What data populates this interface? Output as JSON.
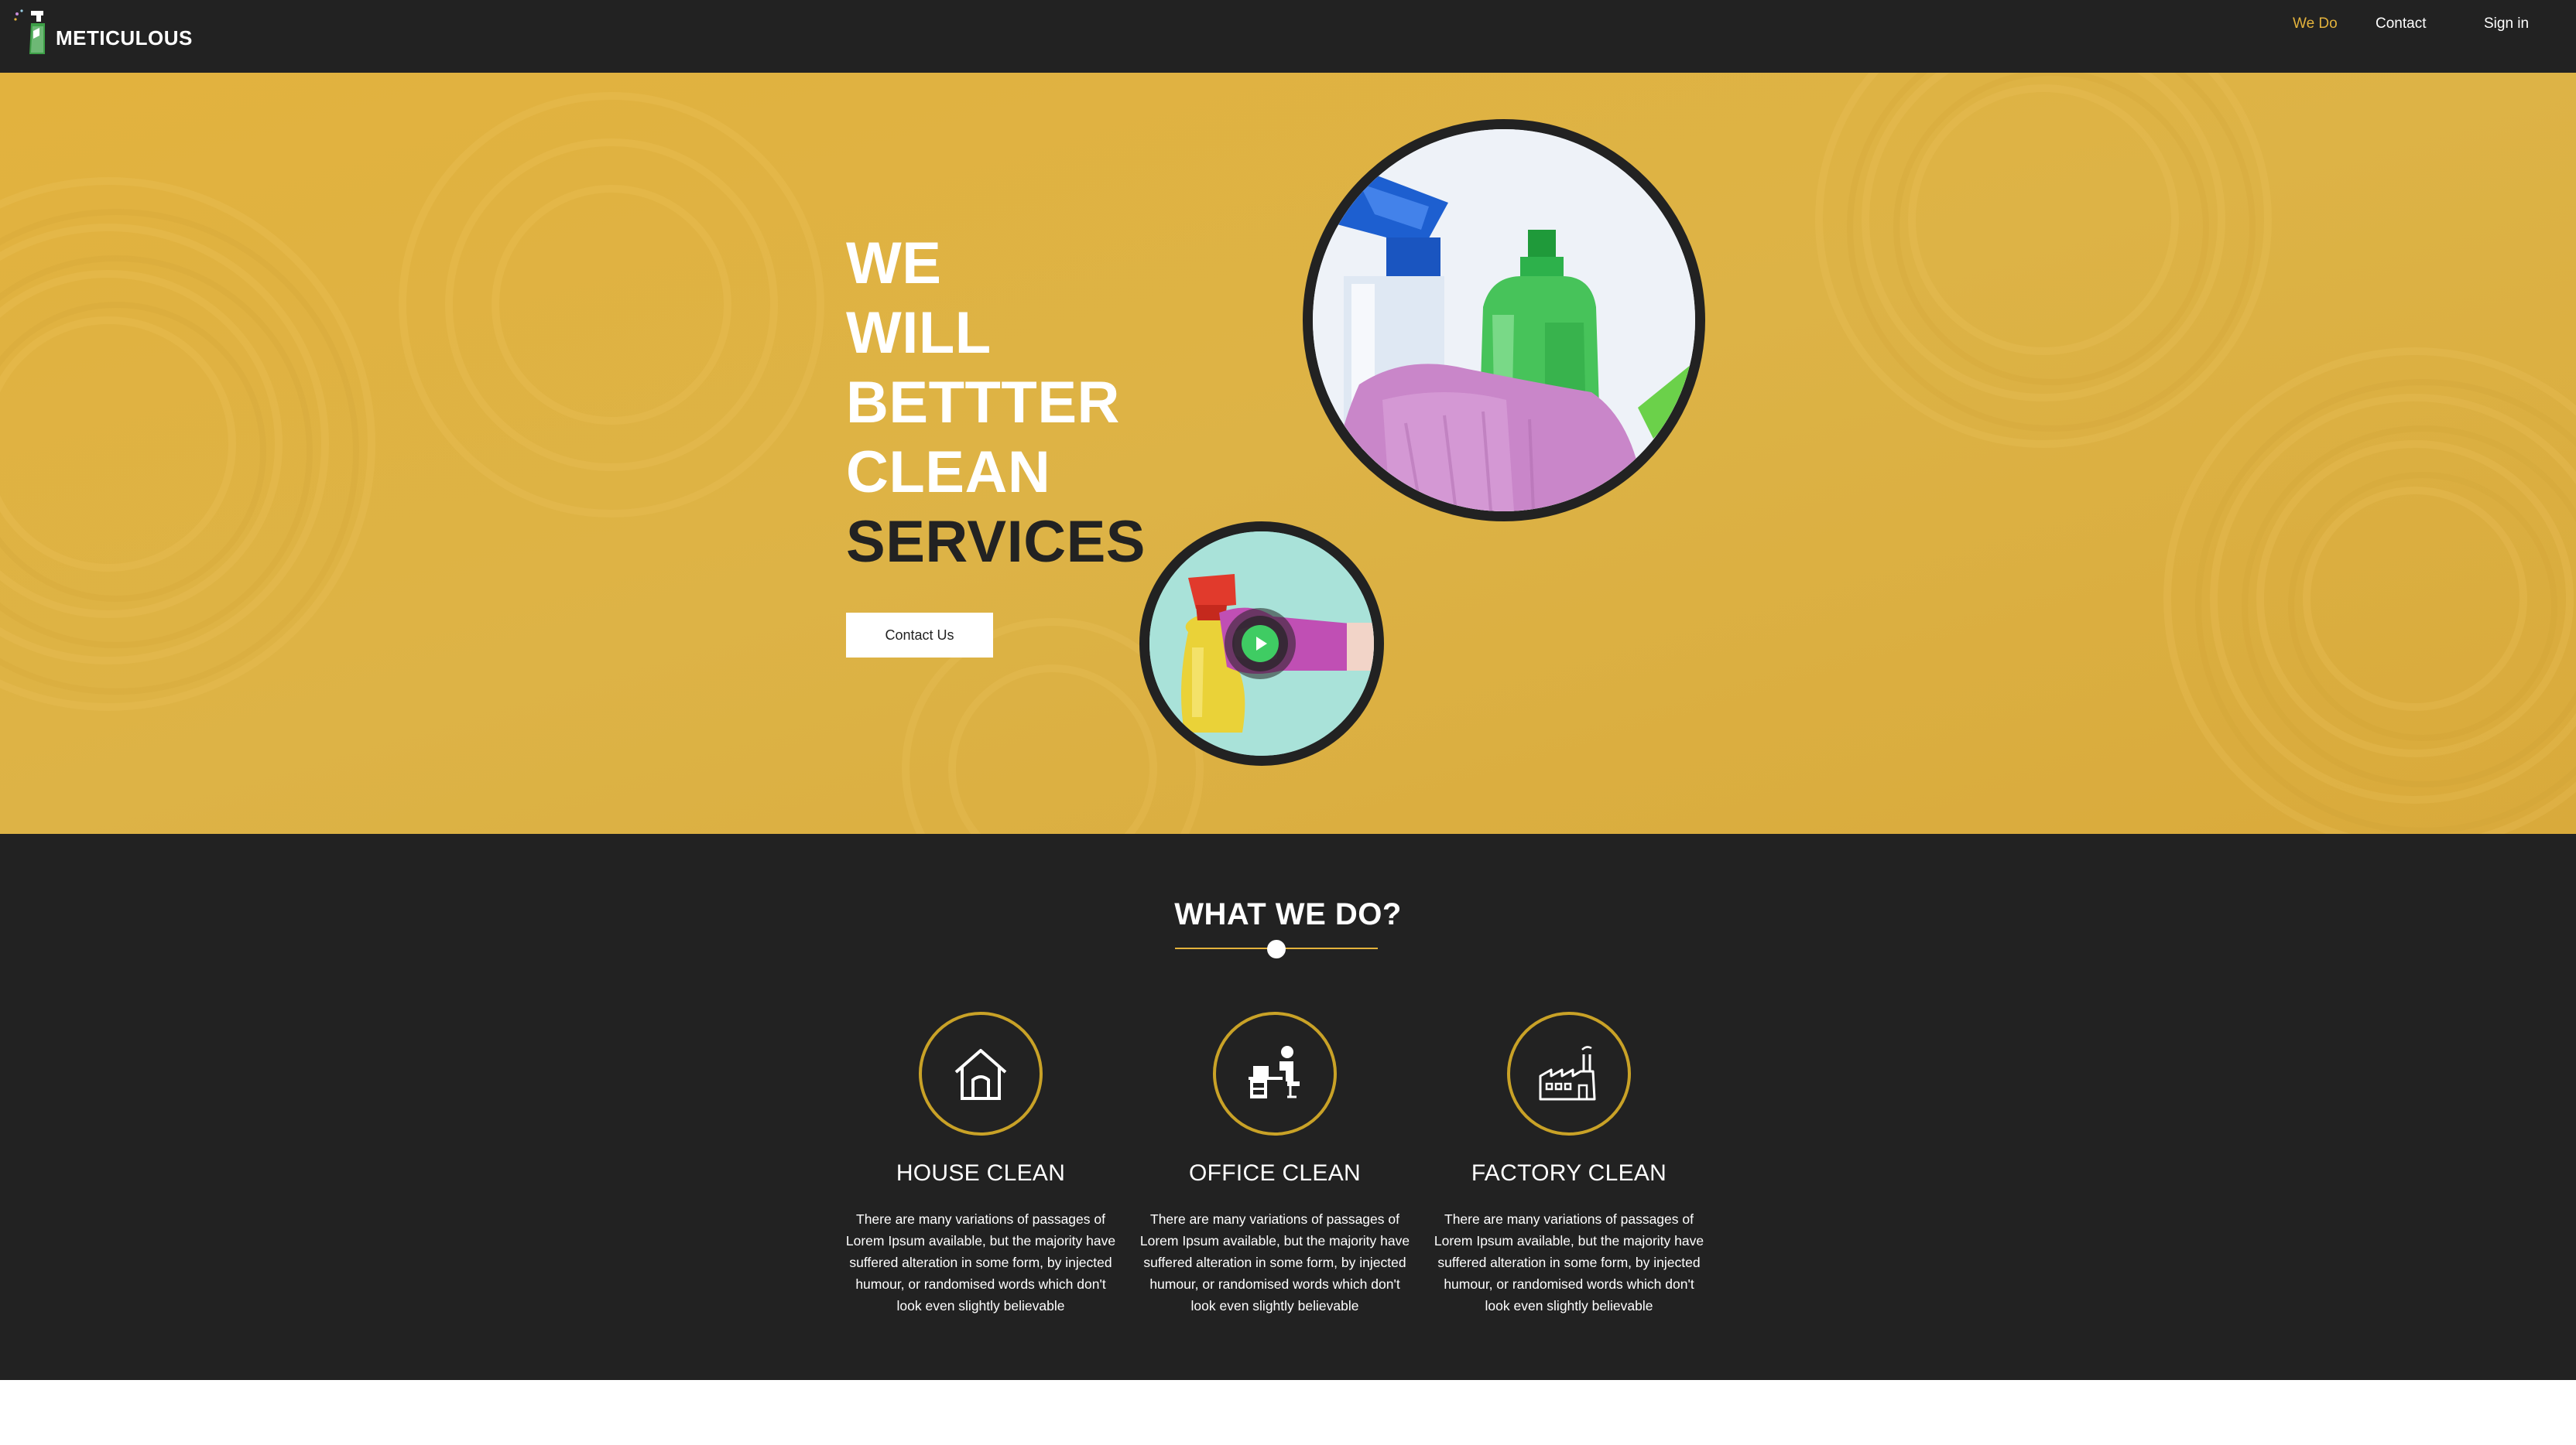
{
  "brand": {
    "name": "METICULOUS",
    "icon": "spray-bottle-logo-icon"
  },
  "nav": {
    "items": [
      {
        "label": "We Do",
        "active": true
      },
      {
        "label": "Contact",
        "active": false
      },
      {
        "label": "Sign in",
        "active": false
      }
    ]
  },
  "hero": {
    "title_lines": [
      "WE",
      "WILL",
      "BETTTER",
      "CLEAN"
    ],
    "title_highlight": "SERVICES",
    "cta_label": "Contact Us",
    "play_icon": "play-icon"
  },
  "services": {
    "title": "WHAT WE DO?",
    "items": [
      {
        "icon": "house-icon",
        "title": "HOUSE CLEAN",
        "text": "There are many variations of passages of Lorem Ipsum available, but the majority have suffered alteration in some form, by injected humour, or randomised words which don't look even slightly believable"
      },
      {
        "icon": "office-desk-icon",
        "title": "OFFICE CLEAN",
        "text": "There are many variations of passages of Lorem Ipsum available, but the majority have suffered alteration in some form, by injected humour, or randomised words which don't look even slightly believable"
      },
      {
        "icon": "factory-icon",
        "title": "FACTORY CLEAN",
        "text": "There are many variations of passages of Lorem Ipsum available, but the majority have suffered alteration in some form, by injected humour, or randomised words which don't look even slightly believable"
      }
    ]
  },
  "colors": {
    "dark": "#222222",
    "accent": "#e3b23c",
    "hero_bg": "#ddb143",
    "white": "#ffffff"
  }
}
